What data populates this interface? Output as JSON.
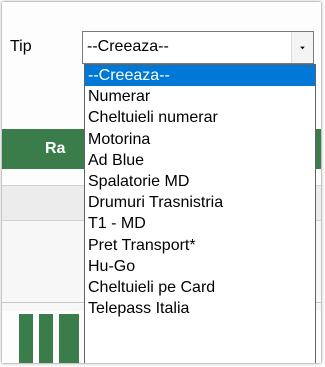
{
  "form": {
    "tip_label": "Tip",
    "combo_value": "--Creeaza--"
  },
  "background": {
    "green_bar_text": "Ra"
  },
  "dropdown": {
    "selected_index": 0,
    "options": [
      "--Creeaza--",
      "Numerar",
      "Cheltuieli numerar",
      "Motorina",
      "Ad Blue",
      "Spalatorie MD",
      "Drumuri Trasnistria",
      "T1 - MD",
      "Pret Transport*",
      "Hu-Go",
      "Cheltuieli pe Card",
      "Telepass Italia"
    ]
  },
  "colors": {
    "selection": "#0078d7",
    "green": "#3a7d4a"
  },
  "icons": {
    "combo_button": "chevron-down-icon"
  }
}
